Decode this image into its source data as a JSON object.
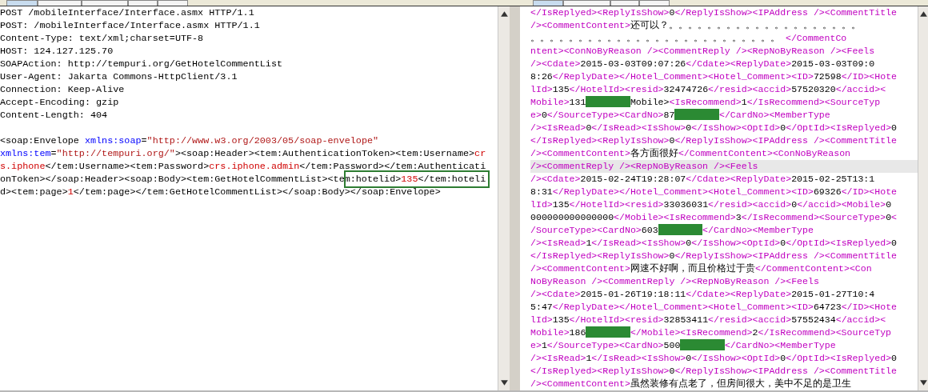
{
  "request": {
    "tabs": [
      {
        "selected": true
      },
      {
        "selected": false
      },
      {
        "selected": false
      },
      {
        "selected": false
      },
      {
        "selected": false
      }
    ],
    "headers": [
      "POST /mobileInterface/Interface.asmx HTTP/1.1",
      "POST: /mobileInterface/Interface.asmx HTTP/1.1",
      "Content-Type: text/xml;charset=UTF-8",
      "HOST: 124.127.125.70",
      "SOAPAction: http://tempuri.org/GetHotelCommentList",
      "User-Agent: Jakarta Commons-HttpClient/3.1",
      "Connection: Keep-Alive",
      "Accept-Encoding: gzip",
      "Content-Length: 404"
    ],
    "body_lines": [
      [
        {
          "kind": "tag",
          "text": "<soap:Envelope "
        },
        {
          "kind": "attr",
          "text": "xmlns:soap"
        },
        {
          "kind": "tag",
          "text": "="
        },
        {
          "kind": "value",
          "text": "\"http://www.w3.org/2003/05/soap-envelope\""
        }
      ],
      [
        {
          "kind": "attr",
          "text": "xmlns:tem"
        },
        {
          "kind": "tag",
          "text": "="
        },
        {
          "kind": "value",
          "text": "\"http://tempuri.org/\""
        },
        {
          "kind": "tag",
          "text": "><soap:Header><tem:AuthenticationToken><tem:Username>"
        },
        {
          "kind": "text",
          "text": "cr"
        }
      ],
      [
        {
          "kind": "text",
          "text": "s.iphone"
        },
        {
          "kind": "tag",
          "text": "</tem:Username><tem:Password>"
        },
        {
          "kind": "text",
          "text": "crs.iphone.admin"
        },
        {
          "kind": "tag",
          "text": "</tem:Password></tem:Authenticati"
        }
      ],
      [
        {
          "kind": "tag",
          "text": "onToken></soap:Header><soap:Body><tem:GetHotelCommentList><tem:hotelid>"
        },
        {
          "kind": "text",
          "text": "135"
        },
        {
          "kind": "tag",
          "text": "</tem:hoteli"
        }
      ],
      [
        {
          "kind": "tag",
          "text": "d><tem:page>"
        },
        {
          "kind": "text",
          "text": "1"
        },
        {
          "kind": "tag",
          "text": "</tem:page></tem:GetHotelCommentList></soap:Body></soap:Envelope>"
        }
      ]
    ],
    "highlight_frame": true
  },
  "response": {
    "tabs": [
      {
        "selected": true
      },
      {
        "selected": false
      },
      {
        "selected": false
      },
      {
        "selected": false
      }
    ],
    "lines": [
      {
        "current": false,
        "parts": [
          "</IsReplyed><ReplyIsShow>0</ReplyIsShow><IPAddress /><CommentTitle"
        ]
      },
      {
        "current": false,
        "parts": [
          "/><CommentContent>还可以？。。。。。。。。。。。。。。。。。。。。"
        ]
      },
      {
        "current": false,
        "parts": [
          "。。。。。。。。。。。。。。。。。。。。。。。。。。 </CommentCo"
        ]
      },
      {
        "current": false,
        "parts": [
          "ntent><ConNoByReason /><CommentReply /><RepNoByReason /><Feels"
        ]
      },
      {
        "current": false,
        "parts": [
          "/><Cdate>2015-03-03T09:07:26</Cdate><ReplyDate>2015-03-03T09:0"
        ]
      },
      {
        "current": false,
        "parts": [
          "8:26</ReplyDate></Hotel_Comment><Hotel_Comment><ID>72598</ID><Hote"
        ]
      },
      {
        "current": false,
        "parts": [
          "lId>135</HotelId><resid>32474726</resid><accid>57520320</accid><"
        ]
      },
      {
        "current": false,
        "parts": [
          "Mobile>131",
          {
            "kind": "redaction"
          },
          "Mobile><IsRecommend>1</IsRecommend><SourceTyp"
        ]
      },
      {
        "current": false,
        "parts": [
          "e>0</SourceType><CardNo>87",
          {
            "kind": "redaction"
          },
          "</CardNo><MemberType"
        ]
      },
      {
        "current": false,
        "parts": [
          "/><IsRead>0</IsRead><IsShow>0</IsShow><OptId>0</OptId><IsReplyed>0"
        ]
      },
      {
        "current": false,
        "parts": [
          "</IsReplyed><ReplyIsShow>0</ReplyIsShow><IPAddress /><CommentTitle"
        ]
      },
      {
        "current": false,
        "parts": [
          "/><CommentContent>各方面很好</CommentContent><ConNoByReason"
        ]
      },
      {
        "current": true,
        "parts": [
          "/><CommentReply /><RepNoByReason /><Feels"
        ]
      },
      {
        "current": false,
        "parts": [
          "/><Cdate>2015-02-24T19:28:07</Cdate><ReplyDate>2015-02-25T13:1"
        ]
      },
      {
        "current": false,
        "parts": [
          "8:31</ReplyDate></Hotel_Comment><Hotel_Comment><ID>69326</ID><Hote"
        ]
      },
      {
        "current": false,
        "parts": [
          "lId>135</HotelId><resid>33036031</resid><accid>0</accid><Mobile>0"
        ]
      },
      {
        "current": false,
        "parts": [
          "000000000000000</Mobile><IsRecommend>3</IsRecommend><SourceType>0<"
        ]
      },
      {
        "current": false,
        "parts": [
          "/SourceType><CardNo>603",
          {
            "kind": "redaction"
          },
          "</CardNo><MemberType"
        ]
      },
      {
        "current": false,
        "parts": [
          "/><IsRead>1</IsRead><IsShow>0</IsShow><OptId>0</OptId><IsReplyed>0"
        ]
      },
      {
        "current": false,
        "parts": [
          "</IsReplyed><ReplyIsShow>0</ReplyIsShow><IPAddress /><CommentTitle"
        ]
      },
      {
        "current": false,
        "parts": [
          "/><CommentContent>网速不好啊，而且价格过于贵</CommentContent><Con"
        ]
      },
      {
        "current": false,
        "parts": [
          "NoByReason /><CommentReply /><RepNoByReason /><Feels"
        ]
      },
      {
        "current": false,
        "parts": [
          "/><Cdate>2015-01-26T19:18:11</Cdate><ReplyDate>2015-01-27T10:4"
        ]
      },
      {
        "current": false,
        "parts": [
          "5:47</ReplyDate></Hotel_Comment><Hotel_Comment><ID>64723</ID><Hote"
        ]
      },
      {
        "current": false,
        "parts": [
          "lId>135</HotelId><resid>32853411</resid><accid>57552434</accid><"
        ]
      },
      {
        "current": false,
        "parts": [
          "Mobile>186",
          {
            "kind": "redaction"
          },
          "</Mobile><IsRecommend>2</IsRecommend><SourceTyp"
        ]
      },
      {
        "current": false,
        "parts": [
          "e>1</SourceType><CardNo>500",
          {
            "kind": "redaction"
          },
          "</CardNo><MemberType"
        ]
      },
      {
        "current": false,
        "parts": [
          "/><IsRead>1</IsRead><IsShow>0</IsShow><OptId>0</OptId><IsReplyed>0"
        ]
      },
      {
        "current": false,
        "parts": [
          "</IsReplyed><ReplyIsShow>0</ReplyIsShow><IPAddress /><CommentTitle"
        ]
      },
      {
        "current": false,
        "parts": [
          "/><CommentContent>虽然装修有点老了，但房间很大，美中不足的是卫生"
        ]
      }
    ]
  }
}
